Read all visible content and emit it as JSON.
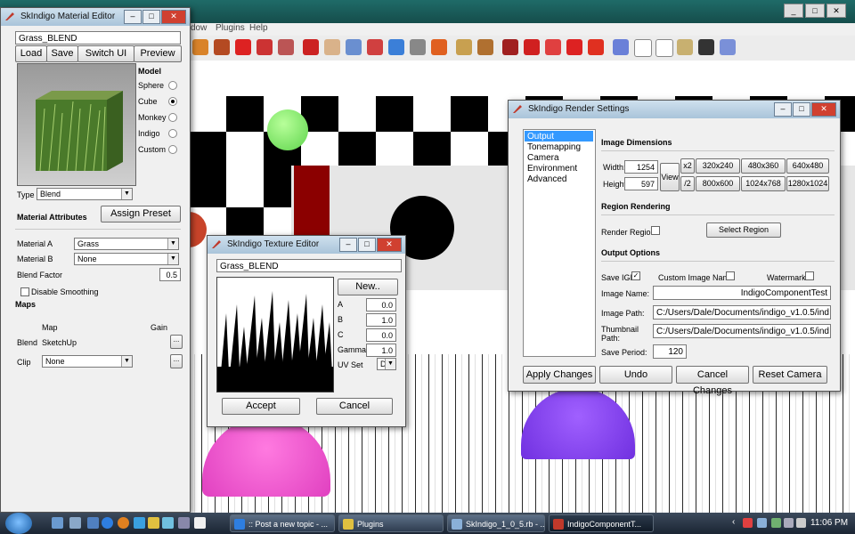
{
  "sketchup": {
    "menu": [
      "dow",
      "Plugins",
      "Help"
    ]
  },
  "material_editor": {
    "title": "SkIndigo Material Editor",
    "material_name": "Grass_BLEND",
    "buttons": {
      "load": "Load",
      "save": "Save",
      "switch_ui": "Switch UI",
      "preview": "Preview"
    },
    "model_heading": "Model",
    "models": [
      {
        "label": "Sphere",
        "selected": false
      },
      {
        "label": "Cube",
        "selected": true
      },
      {
        "label": "Monkey",
        "selected": false
      },
      {
        "label": "Indigo",
        "selected": false
      },
      {
        "label": "Custom",
        "selected": false
      }
    ],
    "type_label": "Type",
    "type_value": "Blend",
    "material_attributes_heading": "Material Attributes",
    "assign_preset": "Assign Preset",
    "material_a_label": "Material A",
    "material_a_value": "Grass",
    "material_b_label": "Material B",
    "material_b_value": "None",
    "blend_factor_label": "Blend Factor",
    "blend_factor_value": "0.5",
    "disable_smoothing": "Disable Smoothing",
    "maps_heading": "Maps",
    "map_col": "Map",
    "gain_col": "Gain",
    "blend_label": "Blend",
    "blend_map": "SketchUp",
    "clip_label": "Clip",
    "clip_map": "None",
    "ellipsis": "..."
  },
  "texture_editor": {
    "title": "SkIndigo Texture Editor",
    "name": "Grass_BLEND",
    "new_button": "New..",
    "params": [
      {
        "label": "A",
        "value": "0.0"
      },
      {
        "label": "B",
        "value": "1.0"
      },
      {
        "label": "C",
        "value": "0.0"
      },
      {
        "label": "Gamma",
        "value": "1.0"
      }
    ],
    "uv_set_label": "UV Set",
    "uv_set_value": "D",
    "accept": "Accept",
    "cancel": "Cancel"
  },
  "render_settings": {
    "title": "SkIndigo Render Settings",
    "nav": [
      "Output",
      "Tonemapping",
      "Camera",
      "Environment",
      "Advanced"
    ],
    "nav_selected": 0,
    "image_dimensions": "Image Dimensions",
    "width_label": "Width:",
    "width_value": "1254",
    "height_label": "Height:",
    "height_value": "597",
    "view_btn": "View",
    "x2_btn": "x2",
    "half_btn": "/2",
    "presets": [
      "320x240",
      "480x360",
      "640x480",
      "800x600",
      "1024x768",
      "1280x1024"
    ],
    "region_rendering": "Region Rendering",
    "render_region": "Render Region",
    "select_region": "Select Region",
    "output_options": "Output Options",
    "save_igi": "Save IGI",
    "custom_image_name": "Custom Image Name",
    "watermark": "Watermark",
    "image_name_label": "Image Name:",
    "image_name_value": "IndigoComponentTest",
    "image_path_label": "Image Path:",
    "image_path_value": "C:/Users/Dale/Documents/indigo_v1.0.5/ind",
    "thumb_path_label_1": "Thumbnail",
    "thumb_path_label_2": "Path:",
    "thumb_path_value": "C:/Users/Dale/Documents/indigo_v1.0.5/ind",
    "save_period_label": "Save Period:",
    "save_period_value": "120",
    "apply": "Apply Changes",
    "undo": "Undo",
    "cancel_changes": "Cancel Changes",
    "reset_camera": "Reset Camera"
  },
  "taskbar": {
    "tasks": [
      ":: Post a new topic - ...",
      "Plugins",
      "SkIndigo_1_0_5.rb - ...",
      "IndigoComponentT..."
    ],
    "active_index": 3,
    "clock": "11:06 PM"
  }
}
